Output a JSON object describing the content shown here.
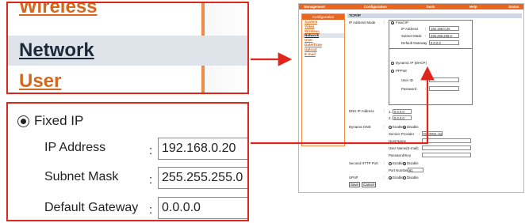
{
  "zoom_menu": {
    "items": [
      {
        "label": "Wireless"
      },
      {
        "label": "Network"
      },
      {
        "label": "User"
      }
    ]
  },
  "zoom_fixed": {
    "radio_label": "Fixed IP",
    "ip_label": "IP Address",
    "ip_value": "192.168.0.20",
    "mask_label": "Subnet Mask",
    "mask_value": "255.255.255.0",
    "gateway_label": "Default Gateway",
    "gateway_value": "0.0.0.0",
    "colon": ":"
  },
  "thumb": {
    "topbar": {
      "management": "Management",
      "configuration": "Configuration",
      "tools": "Tools",
      "help": "Help",
      "status": "Status"
    },
    "sidebar": {
      "header": "Configuration",
      "items": [
        "System",
        "Video",
        "Wireless",
        "Network",
        "User",
        "Date/Time",
        "Upload",
        "E-mail"
      ]
    },
    "section_title": "TCP/IP",
    "ip_mode_label": "IP Address Mode",
    "colon": ":",
    "fixed_ip": "Fixed IP",
    "ip_address_label": "IP Address",
    "ip_address_value": "192.168.0.20",
    "subnet_label": "Subnet Mask",
    "subnet_value": "255.255.255.0",
    "gateway_label": "Default Gateway",
    "gateway_value": "0.0.0.0",
    "dhcp": "Dynamic IP (DHCP)",
    "pppoe": "PPPoE",
    "user_id_label": "User ID",
    "password_label": "Password",
    "dns_label": "DNS IP Address",
    "dns1_index": "1.",
    "dns1_value": "0.0.0.0",
    "dns2_index": "2.",
    "dns2_value": "0.0.0.0",
    "ddns_label": "Dynamic DNS",
    "enable": "Enable",
    "disable": "Disable",
    "service_provider_label": "Service Provider",
    "service_provider_value": "DynDNS.org",
    "host_name_label": "Host Name",
    "user_name_label": "User Name(E-mail)",
    "ddns_password_label": "Password/Key",
    "second_http_label": "Second HTTP Port",
    "port_number_label": "Port Number",
    "port_number_value": "81",
    "upnp_label": "UPnP",
    "save": "Save",
    "cancel": "Cancel"
  },
  "colors": {
    "accent": "#e8661f",
    "callout_red": "#e0261c",
    "menu_link": "#d2691e",
    "active_bg": "#dfe3ea"
  }
}
